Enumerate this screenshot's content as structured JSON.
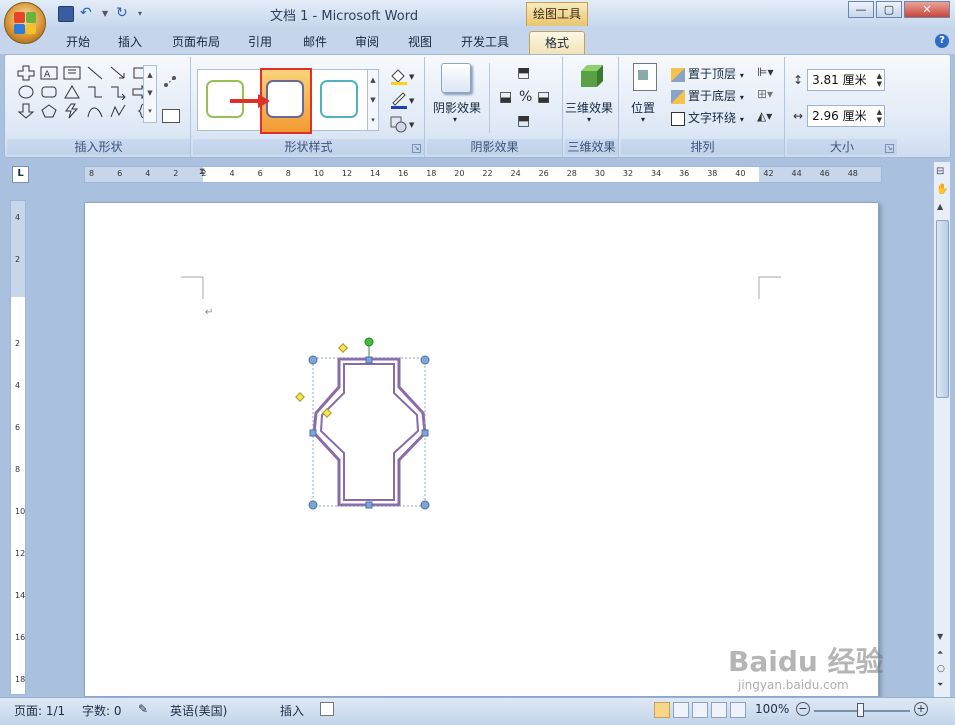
{
  "title": "文档 1 - Microsoft Word",
  "context_tab": "绘图工具",
  "tabs": [
    {
      "label": "开始"
    },
    {
      "label": "插入"
    },
    {
      "label": "页面布局"
    },
    {
      "label": "引用"
    },
    {
      "label": "邮件"
    },
    {
      "label": "审阅"
    },
    {
      "label": "视图"
    },
    {
      "label": "开发工具"
    },
    {
      "label": "格式",
      "active": true
    }
  ],
  "groups": {
    "insert_shapes": "插入形状",
    "shape_styles": "形状样式",
    "shadow_effects": "阴影效果",
    "three_d": "三维效果",
    "arrange": "排列",
    "size": "大小"
  },
  "buttons": {
    "shadow_effects": "阴影效果",
    "three_d_effects": "三维效果",
    "position": "位置",
    "bring_to_front": "置于顶层",
    "send_to_back": "置于底层",
    "text_wrap": "文字环绕"
  },
  "size": {
    "height": "3.81 厘米",
    "width": "2.96 厘米"
  },
  "ruler_h": [
    "8",
    "6",
    "4",
    "2",
    "2",
    "4",
    "6",
    "8",
    "10",
    "12",
    "14",
    "16",
    "18",
    "20",
    "22",
    "24",
    "26",
    "28",
    "30",
    "32",
    "34",
    "36",
    "38",
    "40",
    "42",
    "44",
    "46",
    "48"
  ],
  "ruler_v": [
    "4",
    "2",
    "2",
    "4",
    "6",
    "8",
    "10",
    "12",
    "14",
    "16",
    "18",
    "20",
    "22"
  ],
  "status": {
    "page": "页面: 1/1",
    "words": "字数: 0",
    "language": "英语(美国)",
    "mode": "插入",
    "zoom": "100%"
  },
  "watermark": "Baidu 经验",
  "watermark_sub": "jingyan.baidu.com",
  "colors": {
    "shape_line": "#8a6aa8",
    "highlight_red": "#e0302a",
    "selected_swatch": "#f6a941"
  }
}
